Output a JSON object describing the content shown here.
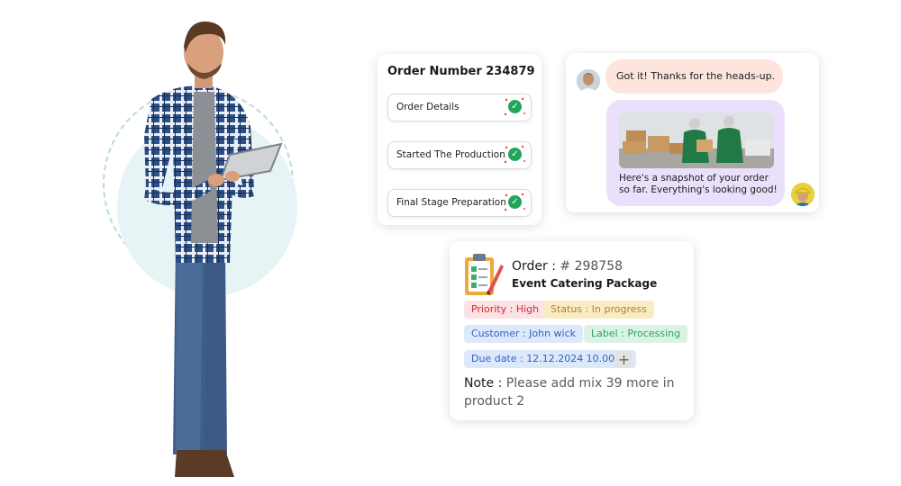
{
  "order_card": {
    "title": "Order Number 234879",
    "steps": [
      {
        "label": "Order Details",
        "done": true
      },
      {
        "label": "Started The Production",
        "done": true
      },
      {
        "label": "Final Stage Preparation",
        "done": true
      }
    ]
  },
  "chat": {
    "incoming": "Got it! Thanks for the heads-up. 😊",
    "outgoing": "Here's a snapshot of your order so far. Everything's looking good!"
  },
  "detail_card": {
    "order_prefix": "Order : ",
    "order_number": "# 298758",
    "package": "Event Catering Package",
    "tags": {
      "priority": "Priority : High",
      "status": "Status : In progress",
      "customer": "Customer : John wick",
      "label": "Label : Processing",
      "due": "Due date : 12.12.2024 10.00PM"
    },
    "add_symbol": "+",
    "note_label": "Note : ",
    "note_text": "Please add mix 39 more in product 2"
  },
  "colors": {
    "check_green": "#1fa65a",
    "incoming_bubble": "#fde5dd",
    "outgoing_bubble": "#ebe0fb",
    "priority": "#d2262e",
    "status": "#b0861c",
    "customer": "#2f63c7",
    "label": "#2ba466"
  },
  "icons": [
    "check-icon",
    "clipboard-icon",
    "plus-icon",
    "avatar"
  ]
}
